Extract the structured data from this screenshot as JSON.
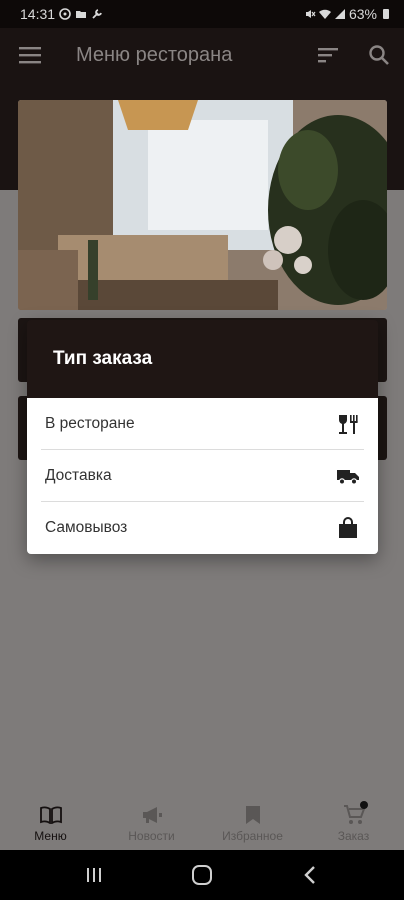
{
  "status_bar": {
    "time": "14:31",
    "battery": "63%"
  },
  "app_bar": {
    "title": "Меню ресторана",
    "menu_icon": "hamburger-icon",
    "sort_icon": "sort-icon",
    "search_icon": "search-icon"
  },
  "dialog": {
    "title": "Тип заказа",
    "options": [
      {
        "label": "В ресторане",
        "icon": "dine-in-icon"
      },
      {
        "label": "Доставка",
        "icon": "delivery-truck-icon"
      },
      {
        "label": "Самовывоз",
        "icon": "shopping-bag-icon"
      }
    ]
  },
  "bottom_nav": {
    "items": [
      {
        "label": "Меню",
        "icon": "book-icon",
        "active": true
      },
      {
        "label": "Новости",
        "icon": "megaphone-icon",
        "active": false
      },
      {
        "label": "Избранное",
        "icon": "bookmark-icon",
        "active": false
      },
      {
        "label": "Заказ",
        "icon": "cart-icon",
        "active": false
      }
    ]
  },
  "colors": {
    "header": "#1a1312",
    "dialog_header": "#1f1614",
    "scrim_background": "#7e7b7a"
  }
}
